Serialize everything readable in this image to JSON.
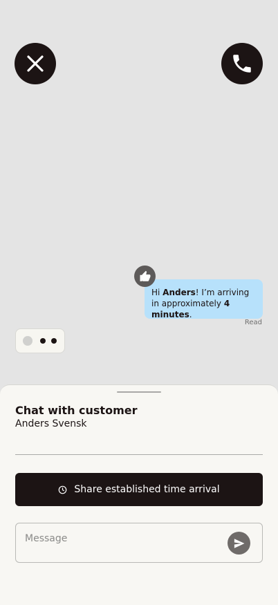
{
  "header": {
    "close_icon": "close-icon",
    "call_icon": "phone-icon"
  },
  "message": {
    "text_prefix": "Hi ",
    "name": "Anders",
    "text_mid": "! I’m arriving in approximately ",
    "eta": "4 minutes",
    "text_suffix": ".",
    "status": "Read",
    "reaction_icon": "thumbs-up-icon",
    "bubble_color": "#b7e1fb"
  },
  "typing_indicator": {
    "icon": "typing-dots-icon"
  },
  "sheet": {
    "title": "Chat with customer",
    "customer_name": "Anders Svensk",
    "share_button_label": "Share established time arrival",
    "share_icon": "clock-icon",
    "message_placeholder": "Message",
    "send_icon": "send-icon"
  },
  "colors": {
    "dark": "#1c1414",
    "background": "#e4e4e4",
    "sheet": "#f8f7f3"
  }
}
